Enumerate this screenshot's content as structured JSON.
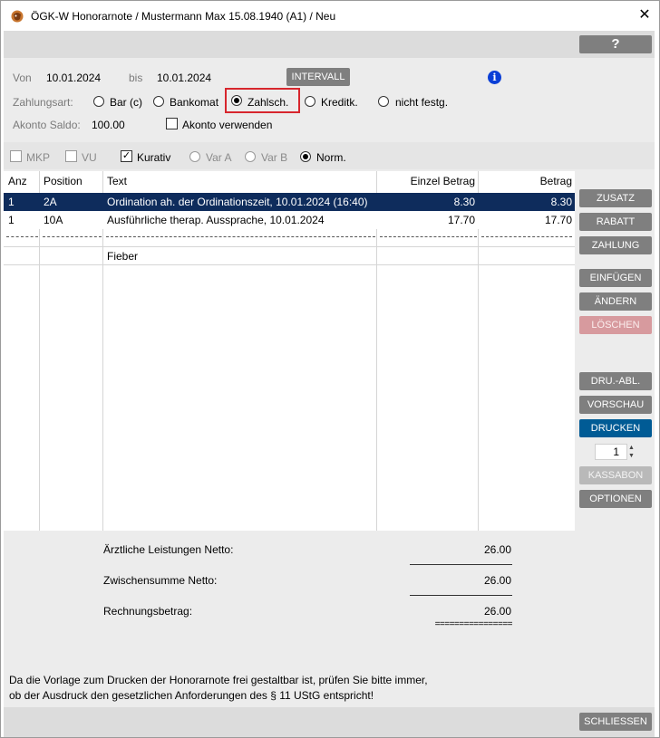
{
  "window": {
    "title": "ÖGK-W Honorarnote / Mustermann Max 15.08.1940 (A1) / Neu",
    "close": "✕"
  },
  "toolbar": {
    "help": "?"
  },
  "dates": {
    "from_label": "Von",
    "from_value": "10.01.2024",
    "to_label": "bis",
    "to_value": "10.01.2024",
    "interval_button": "INTERVALL"
  },
  "payment": {
    "label": "Zahlungsart:",
    "options": [
      "Bar (c)",
      "Bankomat",
      "Zahlsch.",
      "Kreditk.",
      "nicht festg."
    ],
    "selected": "Zahlsch."
  },
  "akonto": {
    "label": "Akonto Saldo:",
    "value": "100.00",
    "use_label": "Akonto verwenden"
  },
  "flags": {
    "mkp": "MKP",
    "vu": "VU",
    "kurativ": "Kurativ",
    "var_a": "Var A",
    "var_b": "Var B",
    "norm": "Norm."
  },
  "table": {
    "headers": {
      "anz": "Anz",
      "position": "Position",
      "text": "Text",
      "einzel": "Einzel Betrag",
      "betrag": "Betrag"
    },
    "rows": [
      {
        "anz": "1",
        "position": "2A",
        "text": "Ordination ah. der Ordinationszeit, 10.01.2024 (16:40)",
        "einzel": "8.30",
        "betrag": "8.30"
      },
      {
        "anz": "1",
        "position": "10A",
        "text": "Ausführliche therap. Aussprache, 10.01.2024",
        "einzel": "17.70",
        "betrag": "17.70"
      }
    ],
    "diagnosis": "Fieber"
  },
  "side_buttons": {
    "zusatz": "ZUSATZ",
    "rabatt": "RABATT",
    "zahlung": "ZAHLUNG",
    "einfuegen": "EINFÜGEN",
    "aendern": "ÄNDERN",
    "loeschen": "LÖSCHEN",
    "druabl": "DRU.-ABL.",
    "vorschau": "VORSCHAU",
    "drucken": "DRUCKEN",
    "copies": "1",
    "kassabon": "KASSABON",
    "optionen": "OPTIONEN"
  },
  "totals": {
    "aerztliche_label": "Ärztliche Leistungen Netto:",
    "aerztliche_value": "26.00",
    "zwischensumme_label": "Zwischensumme Netto:",
    "zwischensumme_value": "26.00",
    "rechnung_label": "Rechnungsbetrag:",
    "rechnung_value": "26.00",
    "double_line": "================"
  },
  "note": {
    "line1": "Da die Vorlage zum Drucken der Honorarnote frei gestaltbar ist, prüfen Sie bitte immer,",
    "line2": "ob der Ausdruck den gesetzlichen Anforderungen des § 11 UStG entspricht!"
  },
  "footer": {
    "close_button": "SCHLIESSEN"
  },
  "colors": {
    "accent_blue": "#005b95",
    "selection": "#0e2c5c",
    "highlight_red": "#d7262d",
    "delete_disabled": "#d79a9e"
  }
}
